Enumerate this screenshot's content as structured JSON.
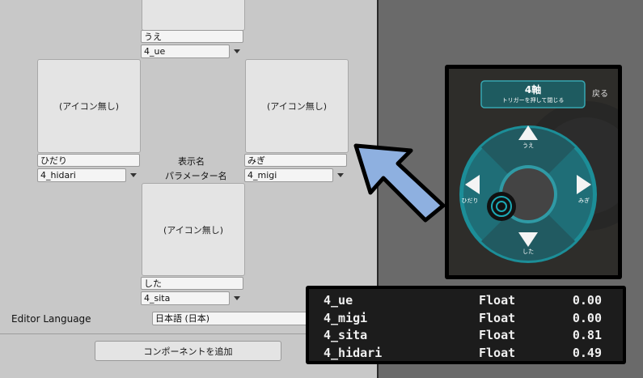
{
  "menu": {
    "no_icon_label": "(アイコン無し)",
    "up": {
      "name": "うえ",
      "param": "4_ue"
    },
    "left": {
      "name": "ひだり",
      "param": "4_hidari"
    },
    "right": {
      "name": "みぎ",
      "param": "4_migi"
    },
    "down": {
      "name": "した",
      "param": "4_sita"
    },
    "center_label_name": "表示名",
    "center_label_param": "パラメーター名"
  },
  "editor_language": {
    "label": "Editor Language",
    "value": "日本語 (日本)"
  },
  "add_component_button": "コンポーネントを追加",
  "radial_preview": {
    "title": "4軸",
    "subtitle": "トリガーを押して閉じる",
    "back": "戻る",
    "up": "うえ",
    "left": "ひだり",
    "right": "みぎ",
    "down": "した"
  },
  "params_table": [
    {
      "name": "4_ue",
      "type": "Float",
      "value": "0.00"
    },
    {
      "name": "4_migi",
      "type": "Float",
      "value": "0.00"
    },
    {
      "name": "4_sita",
      "type": "Float",
      "value": "0.81"
    },
    {
      "name": "4_hidari",
      "type": "Float",
      "value": "0.49"
    }
  ],
  "colors": {
    "arrow": "#8eb0e0",
    "arrow_outline": "#000000",
    "teal": "#1f9aa6"
  }
}
